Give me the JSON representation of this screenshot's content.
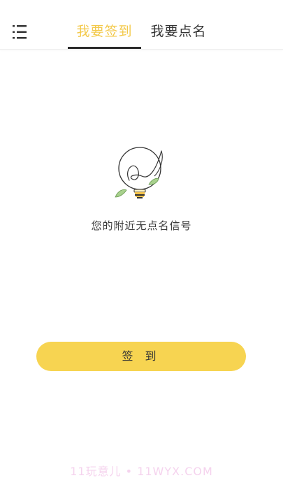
{
  "header": {
    "menu_icon": "list-menu-icon",
    "tabs": [
      {
        "label": "我要签到",
        "active": true
      },
      {
        "label": "我要点名",
        "active": false
      }
    ]
  },
  "main": {
    "illustration_icon": "lightbulb-icon",
    "empty_message": "您的附近无点名信号",
    "action_button_label": "签 到"
  },
  "watermark": "11玩意儿 • 11WYX.COM",
  "colors": {
    "accent": "#f3c94a",
    "button": "#f7d451",
    "text": "#333333",
    "leaf": "#a8d18d"
  }
}
